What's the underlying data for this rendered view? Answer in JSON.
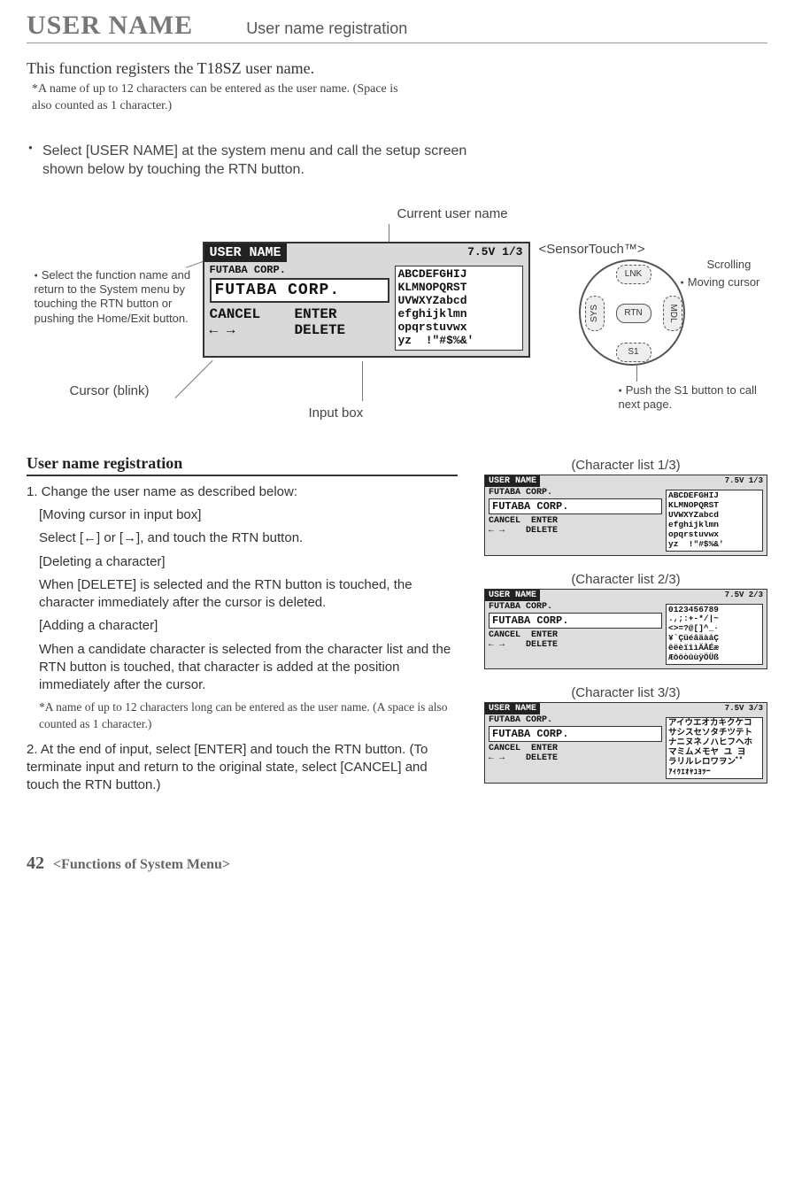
{
  "header": {
    "title": "USER NAME",
    "subtitle": "User name registration"
  },
  "intro": "This function registers the T18SZ user name.",
  "intro_note": "*A name of up to 12 characters can be entered as the user name. (Space is also counted as 1 character.)",
  "select_instruction": "Select [USER NAME] at the system menu and call the setup screen shown below by touching the RTN button.",
  "callouts": {
    "current_user_name": "Current user name",
    "sensortouch": "<SensorTouch™>",
    "scrolling": "Scrolling",
    "moving_cursor": "Moving cursor",
    "select_function": "Select the function name and return to the System menu by touching the RTN button or pushing the Home/Exit button.",
    "cursor_blink": "Cursor (blink)",
    "input_box": "Input box",
    "push_s1": "Push the S1 button to call next page."
  },
  "screen_main": {
    "title_black": "USER NAME",
    "voltage_page": "7.5V 1/3",
    "subline": "FUTABA CORP.",
    "input_value": "FUTABA CORP.",
    "btn_cancel": "CANCEL",
    "btn_enter": "ENTER",
    "arrows": "← →",
    "btn_delete": "DELETE",
    "charlist": "ABCDEFGHIJ\nKLMNOPQRST\nUVWXYZabcd\nefghijklmn\nopqrstuvwx\nyz  !\"#$%&'"
  },
  "sensor": {
    "lnk": "LNK",
    "rtn": "RTN",
    "s1": "S1",
    "sys": "SYS",
    "mdl": "MDL"
  },
  "section_heading": "User name registration",
  "steps": {
    "s1": "1. Change the user name as described below:",
    "s1a_title": "[Moving cursor in input box]",
    "s1a_body": "Select [←] or [→], and touch the RTN button.",
    "s1b_title": "[Deleting a character]",
    "s1b_body": "When [DELETE] is selected and the RTN button is touched, the character immediately after the cursor is deleted.",
    "s1c_title": "[Adding a character]",
    "s1c_body": "When a candidate character is selected from the character list and the RTN button is touched, that character is added at the position immediately after the cursor.",
    "s1_note": "*A name of up to 12 characters long can be entered as the user name. (A space is also counted as 1 character.)",
    "s2": "2. At the end of input, select [ENTER] and touch the RTN button. (To terminate input and return to the original state, select [CANCEL] and touch the RTN button.)"
  },
  "charlists": {
    "l1_label": "(Character list 1/3)",
    "l1_page": "7.5V 1/3",
    "l1_chars": "ABCDEFGHIJ\nKLMNOPQRST\nUVWXYZabcd\nefghijklmn\nopqrstuvwx\nyz  !\"#$%&'",
    "l2_label": "(Character list 2/3)",
    "l2_page": "7.5V 2/3",
    "l2_chars": "0123456789\n.,;:+-*/|~\n<>=?@[]^_·\n¥`ÇüéâäàåÇ\nêëèïîìÄÅÉæ\nÆôöòûùÿÖÜß",
    "l3_label": "(Character list 3/3)",
    "l3_page": "7.5V 3/3",
    "l3_chars": "アイウエオカキクケコ\nサシスセソタチツテト\nナニヌネノハヒフヘホ\nマミムメモヤ ユ ヨ\nラリルレロワヲンﾞﾟ\nｧｨｩｪｫｬｭｮｯｰ"
  },
  "footer": {
    "page": "42",
    "text": "<Functions of System Menu>"
  }
}
